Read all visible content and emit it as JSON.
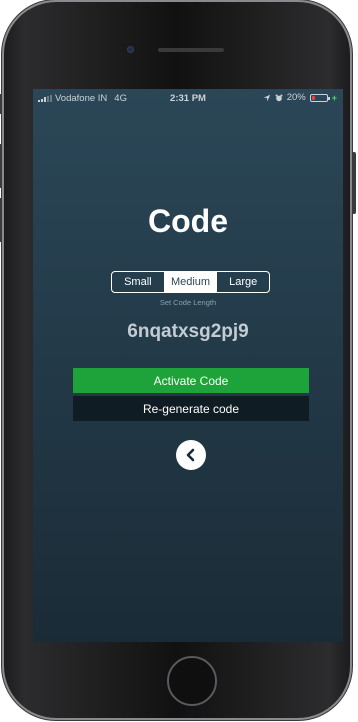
{
  "status_bar": {
    "carrier": "Vodafone IN",
    "network": "4G",
    "time": "2:31 PM",
    "battery_percent": "20%",
    "battery_level": 0.2,
    "location_icon": "location-arrow-icon",
    "alarm_icon": "alarm-icon",
    "charging_icon": "charging-bolt-icon"
  },
  "page": {
    "title": "Code"
  },
  "length_selector": {
    "options": [
      "Small",
      "Medium",
      "Large"
    ],
    "selected": "Medium",
    "caption": "Set Code Length"
  },
  "generated_code": "6nqatxsg2pj9",
  "buttons": {
    "activate_label": "Activate Code",
    "regenerate_label": "Re-generate code",
    "back_icon": "chevron-left-icon"
  },
  "colors": {
    "background_top": "#2b4757",
    "background_bottom": "#1a2b36",
    "activate_button": "#1ea33a",
    "regenerate_button": "#101c23",
    "battery_low": "#ff3b30"
  }
}
